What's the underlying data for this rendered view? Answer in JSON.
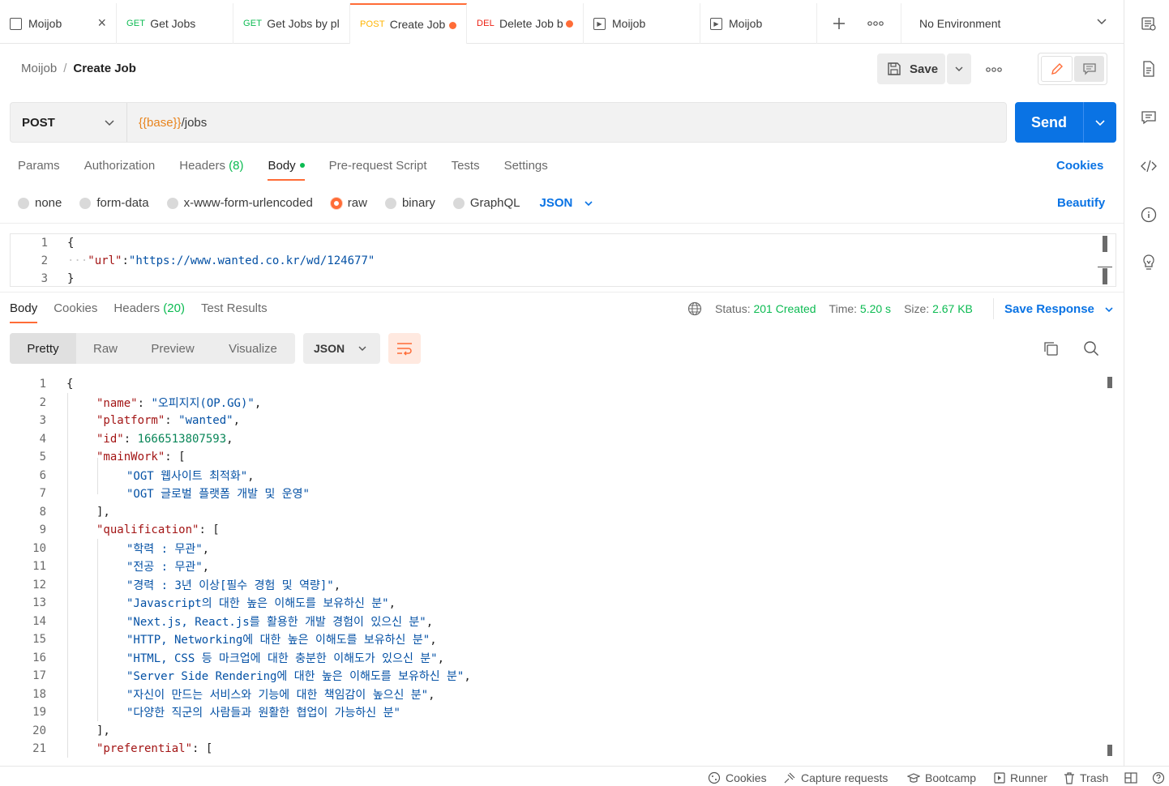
{
  "tabs": [
    {
      "method": "",
      "label": "Moijob",
      "state": "close"
    },
    {
      "method": "GET",
      "label": "Get Jobs",
      "state": ""
    },
    {
      "method": "GET",
      "label": "Get Jobs by pl",
      "state": ""
    },
    {
      "method": "POST",
      "label": "Create Job",
      "state": "unsaved"
    },
    {
      "method": "DEL",
      "label": "Delete Job b",
      "state": "unsaved"
    },
    {
      "method": "",
      "label": "Moijob",
      "state": ""
    },
    {
      "method": "",
      "label": "Moijob",
      "state": ""
    }
  ],
  "environment": "No Environment",
  "breadcrumb": {
    "parent": "Moijob",
    "separator": "/",
    "current": "Create Job"
  },
  "save_label": "Save",
  "request": {
    "method": "POST",
    "url_var": "{{base}}",
    "url_path": "/jobs",
    "send_label": "Send"
  },
  "request_tabs": {
    "params": "Params",
    "authorization": "Authorization",
    "headers": "Headers",
    "headers_count": "(8)",
    "body": "Body",
    "prerequest": "Pre-request Script",
    "tests": "Tests",
    "settings": "Settings",
    "cookies": "Cookies"
  },
  "body_types": {
    "none": "none",
    "form_data": "form-data",
    "urlencoded": "x-www-form-urlencoded",
    "raw": "raw",
    "binary": "binary",
    "graphql": "GraphQL",
    "format": "JSON",
    "beautify": "Beautify"
  },
  "request_body": {
    "line_numbers": [
      "1",
      "2",
      "3"
    ],
    "open": "{",
    "key": "\"url\"",
    "colon": ":",
    "value": "\"https://www.wanted.co.kr/wd/124677\"",
    "close": "}"
  },
  "response_tabs": {
    "body": "Body",
    "cookies": "Cookies",
    "headers": "Headers",
    "headers_count": "(20)",
    "test_results": "Test Results"
  },
  "response_meta": {
    "status_label": "Status:",
    "status_value": "201 Created",
    "time_label": "Time:",
    "time_value": "5.20 s",
    "size_label": "Size:",
    "size_value": "2.67 KB",
    "save_response": "Save Response"
  },
  "view_modes": {
    "pretty": "Pretty",
    "raw": "Raw",
    "preview": "Preview",
    "visualize": "Visualize",
    "format": "JSON"
  },
  "response_lines": [
    {
      "n": "1",
      "indent": 0,
      "key": "",
      "sep": "",
      "val": "",
      "type": "",
      "tail": "{"
    },
    {
      "n": "2",
      "indent": 1,
      "key": "\"name\"",
      "sep": ": ",
      "val": "\"오피지지(OP.GG)\"",
      "type": "str",
      "tail": ","
    },
    {
      "n": "3",
      "indent": 1,
      "key": "\"platform\"",
      "sep": ": ",
      "val": "\"wanted\"",
      "type": "str",
      "tail": ","
    },
    {
      "n": "4",
      "indent": 1,
      "key": "\"id\"",
      "sep": ": ",
      "val": "1666513807593",
      "type": "num",
      "tail": ","
    },
    {
      "n": "5",
      "indent": 1,
      "key": "\"mainWork\"",
      "sep": ": ",
      "val": "",
      "type": "",
      "tail": "["
    },
    {
      "n": "6",
      "indent": 2,
      "key": "",
      "sep": "",
      "val": "\"OGT 웹사이트 최적화\"",
      "type": "str",
      "tail": ","
    },
    {
      "n": "7",
      "indent": 2,
      "key": "",
      "sep": "",
      "val": "\"OGT 글로벌 플랫폼 개발 및 운영\"",
      "type": "str",
      "tail": ""
    },
    {
      "n": "8",
      "indent": 1,
      "key": "",
      "sep": "",
      "val": "",
      "type": "",
      "tail": "],"
    },
    {
      "n": "9",
      "indent": 1,
      "key": "\"qualification\"",
      "sep": ": ",
      "val": "",
      "type": "",
      "tail": "["
    },
    {
      "n": "10",
      "indent": 2,
      "key": "",
      "sep": "",
      "val": "\"학력 : 무관\"",
      "type": "str",
      "tail": ","
    },
    {
      "n": "11",
      "indent": 2,
      "key": "",
      "sep": "",
      "val": "\"전공 : 무관\"",
      "type": "str",
      "tail": ","
    },
    {
      "n": "12",
      "indent": 2,
      "key": "",
      "sep": "",
      "val": "\"경력 : 3년 이상[필수 경험 및 역량]\"",
      "type": "str",
      "tail": ","
    },
    {
      "n": "13",
      "indent": 2,
      "key": "",
      "sep": "",
      "val": "\"Javascript의 대한 높은 이해도를 보유하신 분\"",
      "type": "str",
      "tail": ","
    },
    {
      "n": "14",
      "indent": 2,
      "key": "",
      "sep": "",
      "val": "\"Next.js, React.js를 활용한 개발 경험이 있으신 분\"",
      "type": "str",
      "tail": ","
    },
    {
      "n": "15",
      "indent": 2,
      "key": "",
      "sep": "",
      "val": "\"HTTP, Networking에 대한 높은 이해도를 보유하신 분\"",
      "type": "str",
      "tail": ","
    },
    {
      "n": "16",
      "indent": 2,
      "key": "",
      "sep": "",
      "val": "\"HTML, CSS 등 마크업에 대한 충분한 이해도가 있으신 분\"",
      "type": "str",
      "tail": ","
    },
    {
      "n": "17",
      "indent": 2,
      "key": "",
      "sep": "",
      "val": "\"Server Side Rendering에 대한 높은 이해도를 보유하신 분\"",
      "type": "str",
      "tail": ","
    },
    {
      "n": "18",
      "indent": 2,
      "key": "",
      "sep": "",
      "val": "\"자신이 만드는 서비스와 기능에 대한 책임감이 높으신 분\"",
      "type": "str",
      "tail": ","
    },
    {
      "n": "19",
      "indent": 2,
      "key": "",
      "sep": "",
      "val": "\"다양한 직군의 사람들과 원활한 협업이 가능하신 분\"",
      "type": "str",
      "tail": ""
    },
    {
      "n": "20",
      "indent": 1,
      "key": "",
      "sep": "",
      "val": "",
      "type": "",
      "tail": "],"
    },
    {
      "n": "21",
      "indent": 1,
      "key": "\"preferential\"",
      "sep": ": ",
      "val": "",
      "type": "",
      "tail": "["
    }
  ],
  "statusbar": {
    "cookies": "Cookies",
    "capture": "Capture requests",
    "bootcamp": "Bootcamp",
    "runner": "Runner",
    "trash": "Trash"
  },
  "colors": {
    "accent": "#ff6c37",
    "primary": "#0a73e4",
    "success": "#0cbb52"
  }
}
